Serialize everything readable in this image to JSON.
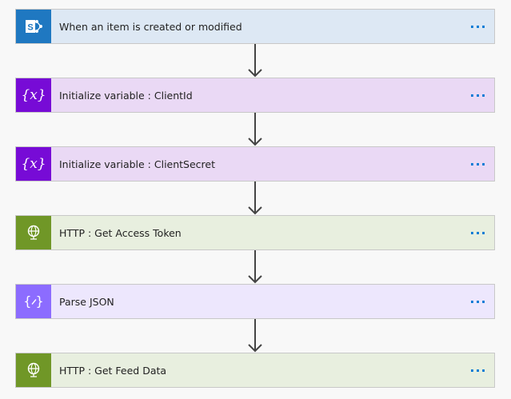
{
  "steps": [
    {
      "label": "When an item is created or modified",
      "icon": "sharepoint-icon",
      "bg": "#dde8f4",
      "icon_bg": "#1f78c1"
    },
    {
      "label": "Initialize variable : ClientId",
      "icon": "variable-icon",
      "bg": "#ead9f5",
      "icon_bg": "#770bd6"
    },
    {
      "label": "Initialize variable : ClientSecret",
      "icon": "variable-icon",
      "bg": "#ead9f5",
      "icon_bg": "#770bd6"
    },
    {
      "label": "HTTP : Get Access Token",
      "icon": "http-globe-icon",
      "bg": "#e8efdf",
      "icon_bg": "#709727"
    },
    {
      "label": "Parse JSON",
      "icon": "parse-json-icon",
      "bg": "#ede7fd",
      "icon_bg": "#8c6cff"
    },
    {
      "label": "HTTP : Get Feed Data",
      "icon": "http-globe-icon",
      "bg": "#e8efdf",
      "icon_bg": "#709727"
    }
  ],
  "more_label": "···"
}
